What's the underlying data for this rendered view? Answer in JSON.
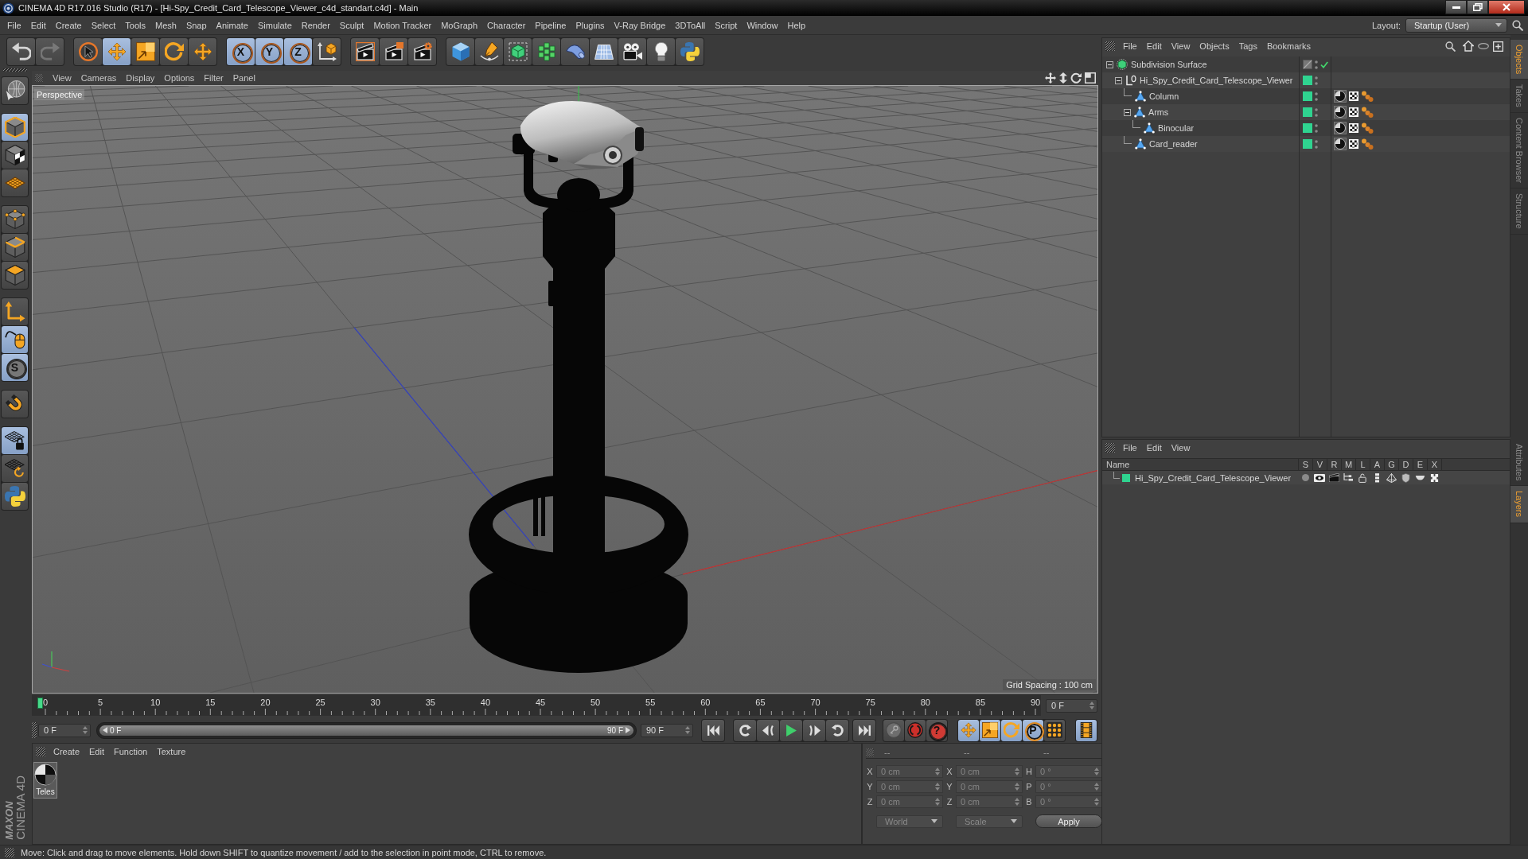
{
  "window": {
    "title": "CINEMA 4D R17.016 Studio (R17) - [Hi-Spy_Credit_Card_Telescope_Viewer_c4d_standart.c4d] - Main"
  },
  "menu_bar": {
    "items": [
      "File",
      "Edit",
      "Create",
      "Select",
      "Tools",
      "Mesh",
      "Snap",
      "Animate",
      "Simulate",
      "Render",
      "Sculpt",
      "Motion Tracker",
      "MoGraph",
      "Character",
      "Pipeline",
      "Plugins",
      "V-Ray Bridge",
      "3DToAll",
      "Script",
      "Window",
      "Help"
    ],
    "layout_label": "Layout:",
    "layout": "Startup (User)"
  },
  "toolbar": {
    "groups": [
      [
        {
          "selected": false,
          "disabled": false
        },
        {
          "selected": false,
          "disabled": true
        }
      ],
      [
        {
          "selected": false
        },
        {
          "selected": true
        },
        {
          "selected": false
        },
        {
          "selected": false
        },
        {
          "selected": false
        }
      ],
      [
        {
          "label": "X",
          "selected": true
        },
        {
          "label": "Y",
          "selected": true
        },
        {
          "label": "Z",
          "selected": true
        },
        {
          "selected": false
        }
      ],
      [
        {
          "selected": false
        },
        {
          "selected": false
        },
        {
          "selected": false
        }
      ],
      [
        {
          "selected": false
        },
        {
          "selected": false
        },
        {
          "selected": false
        },
        {
          "selected": false
        },
        {
          "selected": false
        },
        {
          "selected": false
        },
        {
          "selected": false
        },
        {
          "selected": false
        },
        {
          "selected": false
        }
      ]
    ]
  },
  "tool_palette": {
    "groups": [
      [
        {
          "selected": false
        }
      ],
      [
        {
          "selected": true
        },
        {
          "selected": false
        },
        {
          "selected": false
        }
      ],
      [
        {
          "selected": false
        },
        {
          "selected": false
        },
        {
          "selected": false
        }
      ],
      [
        {
          "selected": false
        },
        {
          "selected": true
        },
        {
          "label": "S",
          "selected": true
        }
      ],
      [
        {
          "selected": false
        }
      ],
      [
        {
          "selected": true
        },
        {
          "selected": false
        },
        {
          "selected": false
        }
      ]
    ],
    "brand": "MAXON",
    "product": "CINEMA 4D"
  },
  "viewport": {
    "menu": [
      "View",
      "Cameras",
      "Display",
      "Options",
      "Filter",
      "Panel"
    ],
    "camera": "Perspective",
    "grid_spacing": "Grid Spacing : 100 cm"
  },
  "timeline": {
    "ticks": [
      "0",
      "5",
      "10",
      "15",
      "20",
      "25",
      "30",
      "35",
      "40",
      "45",
      "50",
      "55",
      "60",
      "65",
      "70",
      "75",
      "80",
      "85",
      "90"
    ],
    "frame": "0 F"
  },
  "transport": {
    "start": "0 F",
    "range": {
      "start": "0 F",
      "end": "90 F",
      "level": 1
    },
    "end": "90 F",
    "key_tools": [
      [
        {
          "selected": false
        },
        {
          "selected": false
        },
        {
          "label": "?",
          "selected": false
        }
      ],
      [
        {
          "selected": true
        },
        {
          "selected": true
        },
        {
          "selected": true
        },
        {
          "label": "P",
          "selected": true
        },
        {
          "selected": false
        }
      ],
      [
        {
          "selected": true
        }
      ]
    ]
  },
  "material_manager": {
    "menu": [
      "Create",
      "Edit",
      "Function",
      "Texture"
    ],
    "materials": [
      {
        "name": "Teles"
      }
    ]
  },
  "coordinates": {
    "headers": [
      "--",
      "--",
      "--"
    ],
    "rows": [
      [
        {
          "label": "X",
          "value": "0 cm"
        },
        {
          "label": "X",
          "value": "0 cm"
        },
        {
          "label": "H",
          "value": "0 °"
        }
      ],
      [
        {
          "label": "Y",
          "value": "0 cm"
        },
        {
          "label": "Y",
          "value": "0 cm"
        },
        {
          "label": "P",
          "value": "0 °"
        }
      ],
      [
        {
          "label": "Z",
          "value": "0 cm"
        },
        {
          "label": "Z",
          "value": "0 cm"
        },
        {
          "label": "B",
          "value": "0 °"
        }
      ]
    ],
    "dropdowns": [
      "World",
      "Scale"
    ],
    "apply": "Apply"
  },
  "object_manager": {
    "menu": [
      "File",
      "Edit",
      "View",
      "Objects",
      "Tags",
      "Bookmarks"
    ],
    "objects": [
      {
        "name": "Subdivision Surface",
        "kind": "generator",
        "expanded": true,
        "enabled": true,
        "children": [
          {
            "name": "Hi_Spy_Credit_Card_Telescope_Viewer",
            "kind": "null",
            "color": "#2fd490",
            "expanded": true,
            "children": [
              {
                "name": "Column",
                "kind": "polygon",
                "color": "#2fd490",
                "tags": [
                  {
                    "kind": "material"
                  },
                  {
                    "kind": "uvw"
                  },
                  {
                    "kind": "phong"
                  }
                ]
              },
              {
                "name": "Arms",
                "kind": "polygon",
                "color": "#2fd490",
                "expanded": true,
                "tags": [
                  {
                    "kind": "material"
                  },
                  {
                    "kind": "uvw"
                  },
                  {
                    "kind": "phong"
                  }
                ],
                "children": [
                  {
                    "name": "Binocular",
                    "kind": "polygon",
                    "color": "#2fd490",
                    "tags": [
                      {
                        "kind": "material"
                      },
                      {
                        "kind": "uvw"
                      },
                      {
                        "kind": "phong"
                      }
                    ]
                  }
                ]
              },
              {
                "name": "Card_reader",
                "kind": "polygon",
                "color": "#2fd490",
                "tags": [
                  {
                    "kind": "material"
                  },
                  {
                    "kind": "uvw"
                  },
                  {
                    "kind": "phong"
                  }
                ]
              }
            ]
          }
        ]
      }
    ]
  },
  "layer_manager": {
    "menu": [
      "File",
      "Edit",
      "View"
    ],
    "columns": [
      "Name",
      "S",
      "V",
      "R",
      "M",
      "L",
      "A",
      "G",
      "D",
      "E",
      "X"
    ],
    "layers": [
      {
        "name": "Hi_Spy_Credit_Card_Telescope_Viewer",
        "color": "#2fd490"
      }
    ]
  },
  "side_tabs": {
    "upper": [
      {
        "label": "Objects",
        "selected": true
      },
      {
        "label": "Takes",
        "selected": false
      },
      {
        "label": "Content Browser",
        "selected": false
      },
      {
        "label": "Structure",
        "selected": false
      }
    ],
    "lower": [
      {
        "label": "Attributes",
        "selected": false
      },
      {
        "label": "Layers",
        "selected": true
      }
    ]
  },
  "status_bar": {
    "text": "Move: Click and drag to move elements. Hold down SHIFT to quantize movement / add to the selection in point mode, CTRL to remove."
  }
}
